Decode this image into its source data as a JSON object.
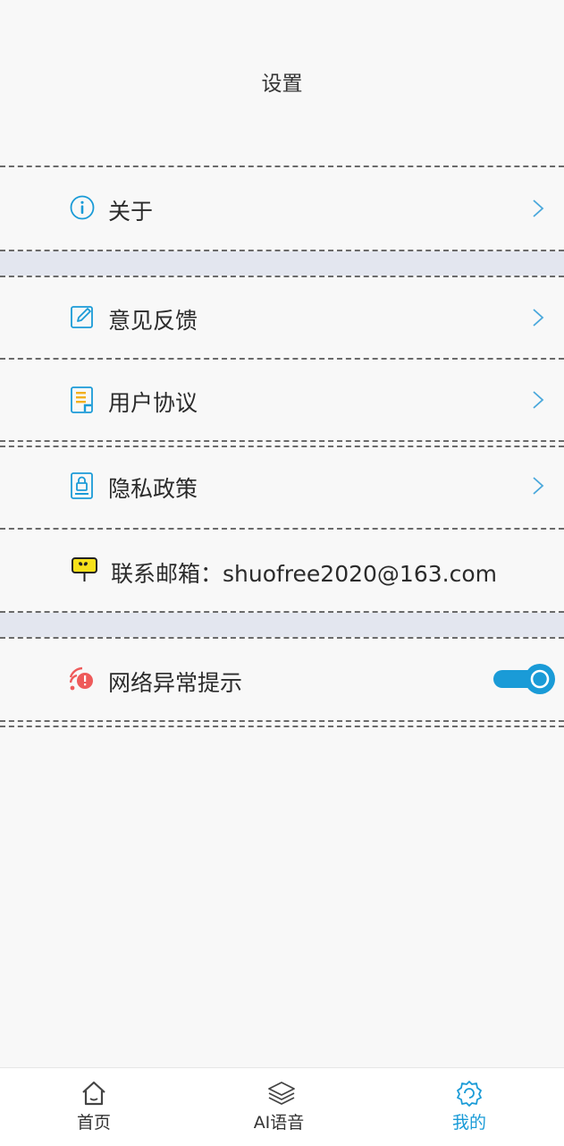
{
  "page_title": "设置",
  "items": {
    "about": {
      "label": "关于",
      "icon": "info-icon"
    },
    "feedback": {
      "label": "意见反馈",
      "icon": "edit-icon"
    },
    "user_agreement": {
      "label": "用户协议",
      "icon": "document-icon"
    },
    "privacy_policy": {
      "label": "隐私政策",
      "icon": "lock-document-icon"
    },
    "contact_email": {
      "label": "联系邮箱：shuofree2020@163.com",
      "icon": "mailbox-icon"
    },
    "network_alert": {
      "label": "网络异常提示",
      "icon": "network-error-icon",
      "enabled": true
    }
  },
  "tabbar": {
    "home": {
      "label": "首页",
      "icon": "home-icon"
    },
    "ai_voice": {
      "label": "AI语音",
      "icon": "layers-icon"
    },
    "mine": {
      "label": "我的",
      "icon": "settings-icon",
      "active": true
    }
  },
  "colors": {
    "accent": "#1a9bd7",
    "section_gap": "#e3e6ef",
    "background": "#f8f8f8"
  }
}
